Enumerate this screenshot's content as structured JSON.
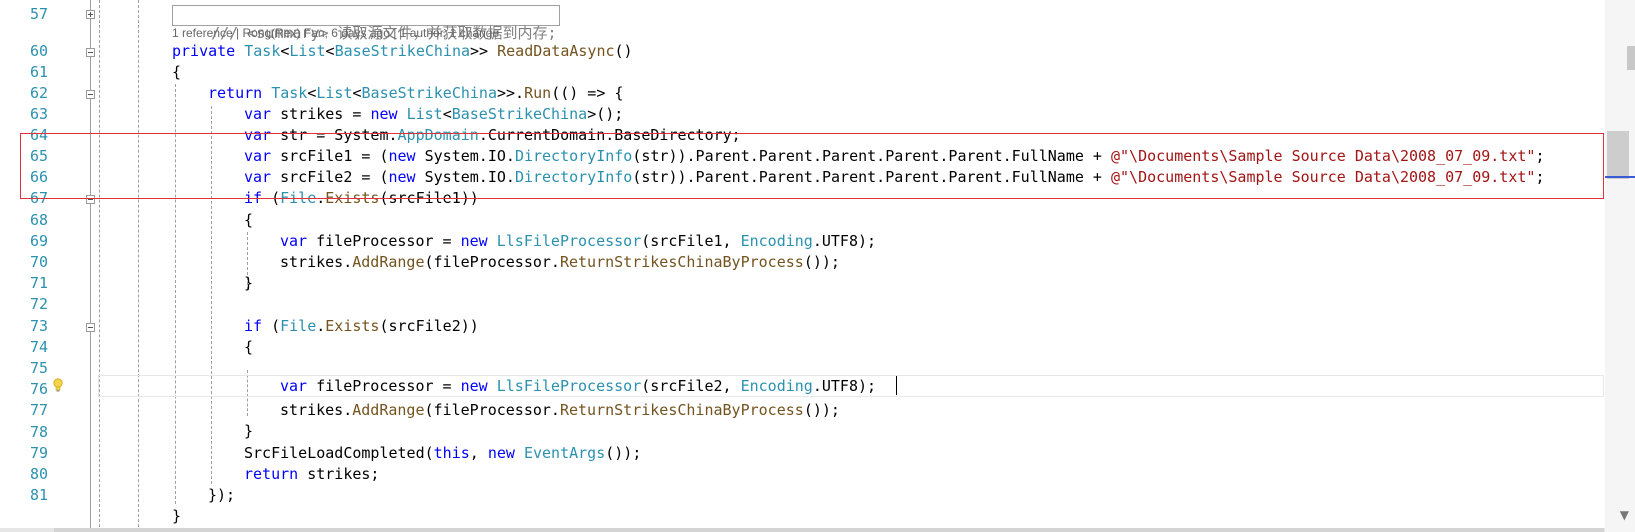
{
  "editor": {
    "line_numbers": [
      "57",
      "60",
      "61",
      "62",
      "63",
      "64",
      "65",
      "66",
      "67",
      "68",
      "69",
      "70",
      "71",
      "72",
      "73",
      "74",
      "75",
      "76",
      "77",
      "78",
      "79",
      "80",
      "81"
    ],
    "codelens": "1 reference | Rong(Rex) Fan, 6 days ago | 1 author, 1 change",
    "lines": {
      "l57": {
        "comment": "/// <summary> 读取源文件，并获取数据到内存;"
      },
      "l60": {
        "kw": "private",
        "t1": "Task",
        "t2": "List",
        "t3": "BaseStrikeChina",
        "m": "ReadDataAsync",
        "rest": "()"
      },
      "l61": {
        "text": "{"
      },
      "l62": {
        "kw": "return",
        "t1": "Task",
        "t2": "List",
        "t3": "BaseStrikeChina",
        "m": "Run",
        "rest": "(() => {"
      },
      "l63": {
        "kw1": "var",
        "a": "strikes = ",
        "kw2": "new",
        "t1": "List",
        "t2": "BaseStrikeChina",
        "rest": "();"
      },
      "l64": {
        "kw": "var",
        "a": "str = System.",
        "t": "AppDomain",
        "b": ".CurrentDomain.BaseDirectory;"
      },
      "l65": {
        "kw": "var",
        "a": "srcFile1 = (",
        "kw2": "new",
        "b": "System.IO.",
        "t": "DirectoryInfo",
        "c": "(str)).Parent.Parent.Parent.Parent.Parent.FullName + ",
        "s": "@\"\\Documents\\Sample Source Data\\2008_07_09.txt\"",
        "d": ";"
      },
      "l66": {
        "kw": "var",
        "a": "srcFile2 = (",
        "kw2": "new",
        "b": "System.IO.",
        "t": "DirectoryInfo",
        "c": "(str)).Parent.Parent.Parent.Parent.Parent.FullName + ",
        "s": "@\"\\Documents\\Sample Source Data\\2008_07_09.txt\"",
        "d": ";"
      },
      "l67": {
        "kw": "if",
        "a": "(",
        "t": "File",
        "b": ".",
        "m": "Exists",
        "c": "(srcFile1))"
      },
      "l68": {
        "text": "{"
      },
      "l69": {
        "kw": "var",
        "a": "fileProcessor = ",
        "kw2": "new",
        "t": "LlsFileProcessor",
        "b": "(srcFile1, ",
        "t2": "Encoding",
        "c": ".UTF8);"
      },
      "l70": {
        "a": "strikes.",
        "m": "AddRange",
        "b": "(fileProcessor.",
        "m2": "ReturnStrikesChinaByProcess",
        "c": "());"
      },
      "l71": {
        "text": "}"
      },
      "l73": {
        "kw": "if",
        "a": "(",
        "t": "File",
        "b": ".",
        "m": "Exists",
        "c": "(srcFile2))"
      },
      "l74": {
        "text": "{"
      },
      "l75": {
        "kw": "var",
        "a": "fileProcessor = ",
        "kw2": "new",
        "t": "LlsFileProcessor",
        "b": "(srcFile2, ",
        "t2": "Encoding",
        "c": ".UTF8);"
      },
      "l76": {
        "a": "strikes.",
        "m": "AddRange",
        "b": "(fileProcessor.",
        "m2": "ReturnStrikesChinaByProcess",
        "c": "());"
      },
      "l77": {
        "text": "}"
      },
      "l78": {
        "a": "SrcFileLoadCompleted(",
        "kw": "this",
        "b": ", ",
        "kw2": "new",
        "t": "EventArgs",
        "c": "());"
      },
      "l79": {
        "kw": "return",
        "a": "strikes;"
      },
      "l80": {
        "text": "});"
      },
      "l81": {
        "text": "}"
      }
    }
  }
}
